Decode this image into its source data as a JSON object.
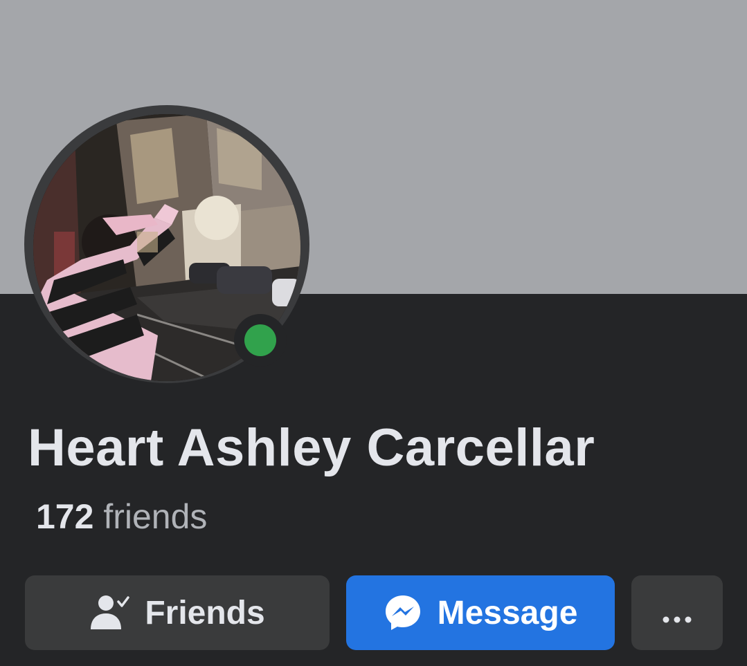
{
  "profile": {
    "name": "Heart Ashley Carcellar",
    "friends_count": "172",
    "friends_label": "friends",
    "online_status_color": "#31a24c"
  },
  "actions": {
    "friends_label": "Friends",
    "friends_icon": "person-check-icon",
    "message_label": "Message",
    "message_icon": "messenger-icon",
    "more_icon": "more-dots-icon"
  },
  "colors": {
    "cover": "#a4a6aa",
    "background": "#242527",
    "primary_button": "#2374e1",
    "secondary_button": "#3a3b3c"
  }
}
